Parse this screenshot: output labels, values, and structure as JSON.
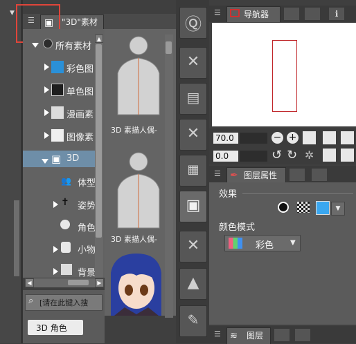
{
  "material_panel": {
    "tab_label": "\"3D\"素材",
    "tree": [
      {
        "label": "所有素材"
      },
      {
        "label": "彩色图"
      },
      {
        "label": "单色图"
      },
      {
        "label": "漫画素"
      },
      {
        "label": "图像素"
      },
      {
        "label": "3D"
      },
      {
        "label": "体型"
      },
      {
        "label": "姿势"
      },
      {
        "label": "角色"
      },
      {
        "label": "小物"
      },
      {
        "label": "背景"
      }
    ],
    "thumbnails": [
      {
        "caption": "3D 素描人偶-"
      },
      {
        "caption": "3D 素描人偶-"
      }
    ],
    "search_placeholder": "[请在此键入搜",
    "tag_label": "3D 角色"
  },
  "navigator": {
    "tab_label": "导航器",
    "zoom_value": "70.0",
    "rotate_value": "0.0"
  },
  "layer_property": {
    "tab_label": "图层属性",
    "effect_label": "效果",
    "color_mode_label": "颜色模式",
    "color_mode_value": "彩色"
  },
  "layer_panel": {
    "tab_label": "图层"
  },
  "colors": {
    "highlight_box": "#e0453a",
    "nav_frame": "#c0262a",
    "selected_row": "#6e8ea8",
    "color_swatch_blue": "#3aa7f0"
  }
}
